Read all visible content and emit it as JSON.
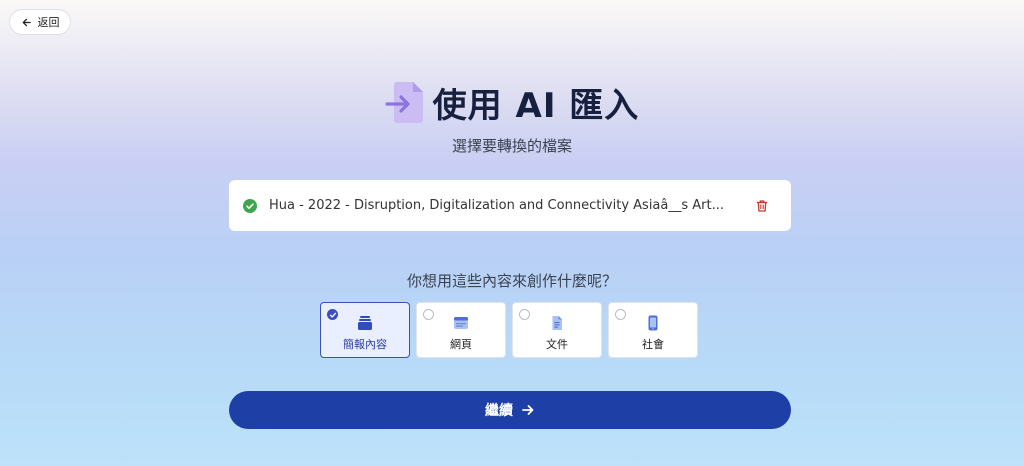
{
  "nav": {
    "back_label": "返回"
  },
  "header": {
    "title": "使用 AI 匯入",
    "subtitle": "選擇要轉換的檔案"
  },
  "file": {
    "name": "Hua - 2022 - Disruption, Digitalization and Connectivity Asiaâ__s Art..."
  },
  "question": "你想用這些內容來創作什麼呢？",
  "options": [
    {
      "label": "簡報內容",
      "icon": "presentation-icon",
      "selected": true
    },
    {
      "label": "網頁",
      "icon": "webpage-icon",
      "selected": false
    },
    {
      "label": "文件",
      "icon": "document-icon",
      "selected": false
    },
    {
      "label": "社會",
      "icon": "mobile-icon",
      "selected": false
    }
  ],
  "continue_label": "繼續",
  "colors": {
    "accent": "#1e3fa6",
    "success": "#3ea54c",
    "danger": "#c0392b",
    "icon_blue": "#4f6fd4"
  }
}
